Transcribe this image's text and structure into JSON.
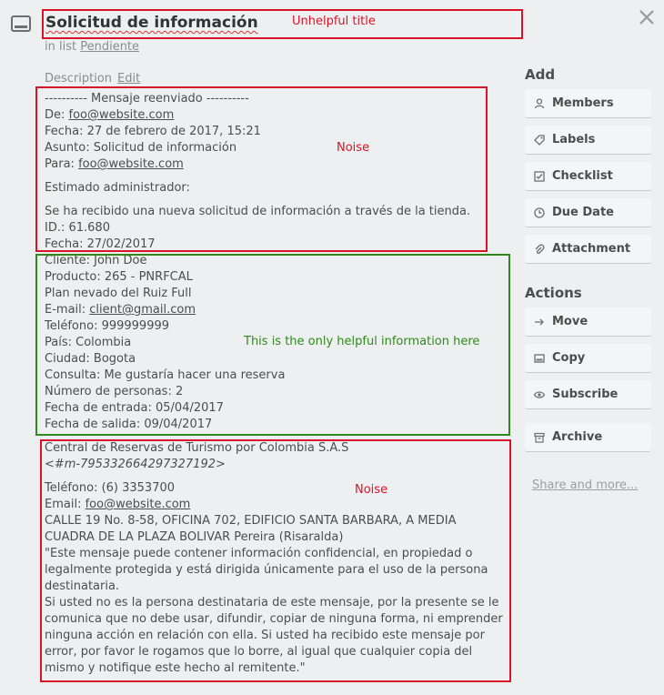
{
  "card": {
    "title": "Solicitud de información",
    "in_list_prefix": "in list",
    "list_name": "Pendiente",
    "description_label": "Description",
    "edit_label": "Edit"
  },
  "description": {
    "block1": [
      "---------- Mensaje reenviado ----------",
      "Fecha: 27 de febrero de 2017, 15:21",
      "Asunto: Solicitud de información",
      "Estimado administrador:",
      "Se ha recibido una nueva solicitud de información a través de la tienda. ID.: 61.680",
      "Fecha: 27/02/2017"
    ],
    "de_label": "De:",
    "de_email": "foo@website.com",
    "para_label": "Para:",
    "para_email": "foo@website.com",
    "block2": [
      "Cliente: John Doe",
      "Producto: 265 - PNRFCAL",
      "Plan nevado del Ruiz Full",
      "Teléfono: 999999999",
      "País: Colombia",
      "Ciudad: Bogota",
      "Consulta: Me gustaría hacer una reserva",
      "Número de personas: 2",
      "Fecha de entrada: 05/04/2017",
      "Fecha de salida: 09/04/2017"
    ],
    "email_label": "E-mail:",
    "client_email": "client@gmail.com",
    "block3": [
      "Central de Reservas de Turismo por Colombia S.A.S",
      "<#m-795332664297327192>",
      "Teléfono: (6) 3353700",
      "CALLE 19 No. 8-58, OFICINA 702, EDIFICIO SANTA BARBARA, A MEDIA CUADRA DE LA PLAZA BOLIVAR Pereira (Risaralda)",
      "\"Este mensaje puede contener información confidencial, en propiedad o legalmente protegida y está dirigida únicamente para el uso de la persona destinataria.",
      "Si usted no es la persona destinataria de este mensaje, por la presente se le comunica que no debe usar, difundir, copiar de ninguna forma, ni emprender ninguna acción en relación con ella. Si usted ha recibido este mensaje por error, por favor le rogamos que lo borre, al igual que cualquier copia del mismo y notifique este hecho al remitente.\""
    ],
    "email3_label": "Email:",
    "email3": "foo@website.com"
  },
  "annotations": {
    "title_note": "Unhelpful title",
    "noise1": "Noise",
    "helpful": "This is the only helpful information here",
    "noise2": "Noise",
    "red": "#d9142a",
    "green": "#2f8a1e"
  },
  "sidebar": {
    "add_heading": "Add",
    "add": [
      {
        "label": "Members",
        "icon": "person-icon"
      },
      {
        "label": "Labels",
        "icon": "tag-icon"
      },
      {
        "label": "Checklist",
        "icon": "checkbox-icon"
      },
      {
        "label": "Due Date",
        "icon": "clock-icon"
      },
      {
        "label": "Attachment",
        "icon": "paperclip-icon"
      }
    ],
    "actions_heading": "Actions",
    "actions": [
      {
        "label": "Move",
        "icon": "arrow-right-icon"
      },
      {
        "label": "Copy",
        "icon": "card-icon"
      },
      {
        "label": "Subscribe",
        "icon": "eye-icon"
      },
      {
        "label": "Archive",
        "icon": "archive-icon"
      }
    ],
    "share_label": "Share and more..."
  }
}
